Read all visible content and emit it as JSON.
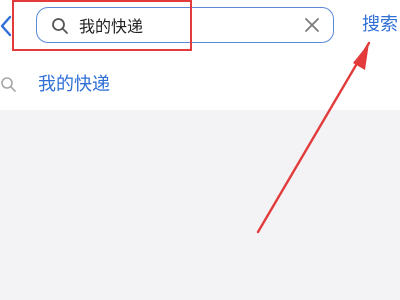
{
  "search": {
    "value": "我的快递",
    "action_label": "搜索"
  },
  "suggestions": [
    {
      "label": "我的快递"
    }
  ],
  "colors": {
    "accent": "#2f6fd6",
    "annotation": "#e33b3b",
    "field_border": "#5b89d8"
  }
}
